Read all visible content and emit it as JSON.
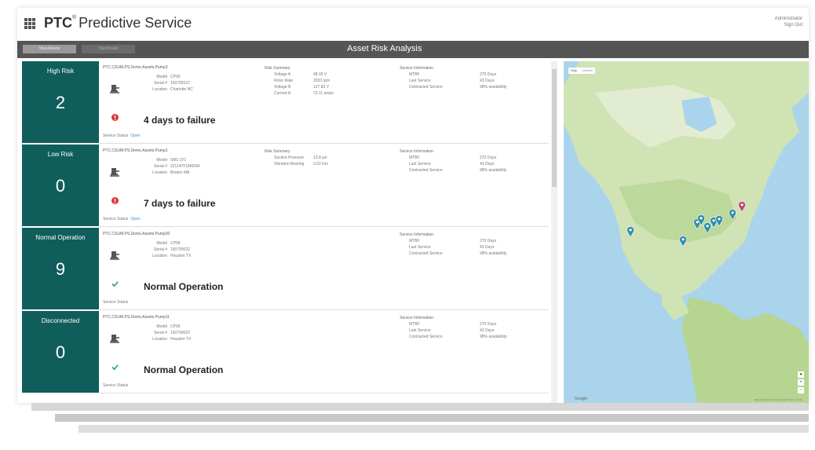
{
  "header": {
    "brand_bold": "PTC",
    "brand_rest": "Predictive Service",
    "user_line1": "Administrator",
    "user_line2": "Sign Out"
  },
  "titlebar": {
    "button1": "View Assets",
    "button2": "Dashboard",
    "title": "Asset Risk Analysis"
  },
  "tiles": [
    {
      "label": "High Risk",
      "count": "2"
    },
    {
      "label": "Low Risk",
      "count": "0"
    },
    {
      "label": "Normal Operation",
      "count": "9"
    },
    {
      "label": "Disconnected",
      "count": "0"
    }
  ],
  "labels": {
    "model": "Model",
    "serial": "Serial #",
    "location": "Location",
    "risk_summary": "Risk Summary",
    "service_info": "Service Information",
    "mtbf": "MTBF",
    "last_service": "Last Service",
    "contracted": "Contracted Service",
    "service_status": "Service Status",
    "open": "Open"
  },
  "cards": [
    {
      "name": "PTC.CSUM.PS.Demo.Assets.Pump3",
      "model": "CP99",
      "serial": "150799127",
      "location": "Charlotte NC",
      "risk": [
        {
          "k": "Voltage A",
          "v": "48.93 V"
        },
        {
          "k": "Rotor Rate",
          "v": "2933 rpm"
        },
        {
          "k": "Voltage B",
          "v": "127.83 V"
        },
        {
          "k": "Current A",
          "v": "73.11 amps"
        }
      ],
      "mtbf": "270 Days",
      "last_service": "43 Days",
      "contracted": "98% availability",
      "status": "4 days to failure"
    },
    {
      "name": "PTC.CSUM.PS.Demo.Assets.Pump1",
      "model": "SM1-371",
      "serial": "221147F1M6034",
      "location": "Boston MA",
      "risk": [
        {
          "k": "Suction Pressure",
          "v": "13.8 psi"
        },
        {
          "k": "Vibration Bearing",
          "v": "0.02 in/s"
        }
      ],
      "mtbf": "270 Days",
      "last_service": "43 Days",
      "contracted": "98% availability",
      "status": "7 days to failure"
    },
    {
      "name": "PTC.CSUM.PS.Demo.Assets.Pump20",
      "model": "CP99",
      "serial": "150799022",
      "location": "Houston TX",
      "risk": [],
      "mtbf": "270 Days",
      "last_service": "43 Days",
      "contracted": "98% availability",
      "status": "Normal Operation"
    },
    {
      "name": "PTC.CSUM.PS.Demo.Assets.Pump11",
      "model": "CP99",
      "serial": "150799022",
      "location": "Houston TX",
      "risk": [],
      "mtbf": "270 Days",
      "last_service": "43 Days",
      "contracted": "98% availability",
      "status": "Normal Operation"
    }
  ],
  "map": {
    "tab_map": "Map",
    "tab_satellite": "Satellite",
    "footer_logo": "Google",
    "footer_text": "Map data ©2016 Google, INEGI   Terms of Use"
  },
  "colors": {
    "tile": "#0f5e5c",
    "alert": "#d9363e",
    "ok": "#2aa07a",
    "marker": "#2f8ea8",
    "marker_alert": "#b94a6a"
  }
}
